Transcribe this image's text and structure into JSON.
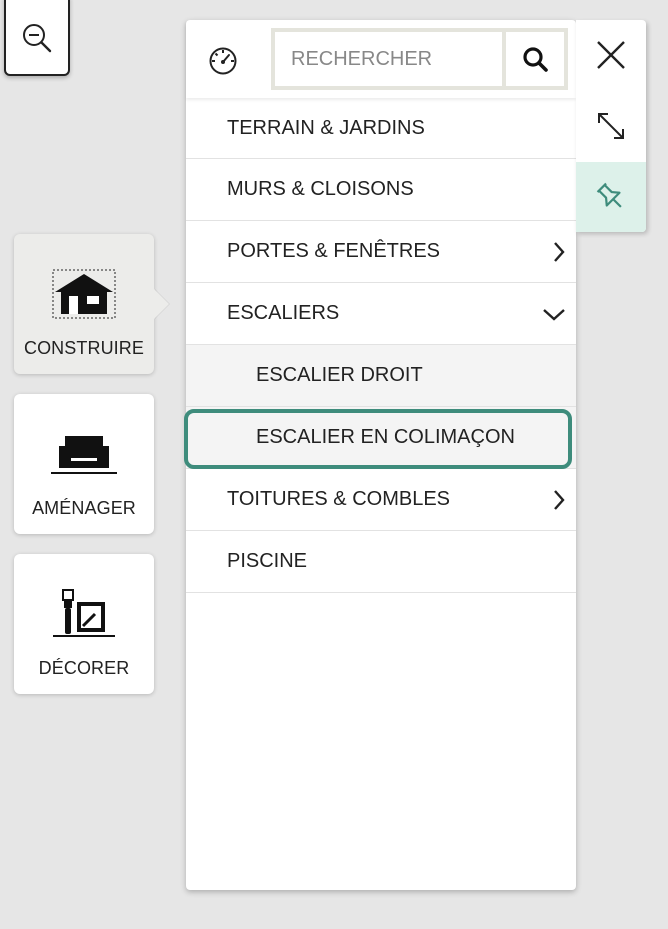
{
  "categories": [
    {
      "label": "CONSTRUIRE",
      "icon": "house-icon",
      "active": true
    },
    {
      "label": "AMÉNAGER",
      "icon": "sofa-icon",
      "active": false
    },
    {
      "label": "DÉCORER",
      "icon": "paint-roller-icon",
      "active": false
    }
  ],
  "search": {
    "placeholder": "RECHERCHER"
  },
  "menu": {
    "items": [
      {
        "label": "TERRAIN & JARDINS"
      },
      {
        "label": "MURS & CLOISONS"
      },
      {
        "label": "PORTES & FENÊTRES",
        "chevron": "right"
      },
      {
        "label": "ESCALIERS",
        "chevron": "down"
      },
      {
        "label": "ESCALIER DROIT",
        "sub": true
      },
      {
        "label": "ESCALIER EN COLIMAÇON",
        "sub": true,
        "selected": true
      },
      {
        "label": "TOITURES & COMBLES",
        "chevron": "right"
      },
      {
        "label": "PISCINE"
      }
    ]
  },
  "icons": {
    "zoom": "zoom-out-icon",
    "header": "gauge-icon",
    "search": "search-icon",
    "tools": [
      "close-icon",
      "expand-icon",
      "pin-icon"
    ]
  },
  "colors": {
    "accent": "#3e8c7c",
    "pin_bg": "#ddf1ea",
    "background": "#e6e6e6"
  }
}
